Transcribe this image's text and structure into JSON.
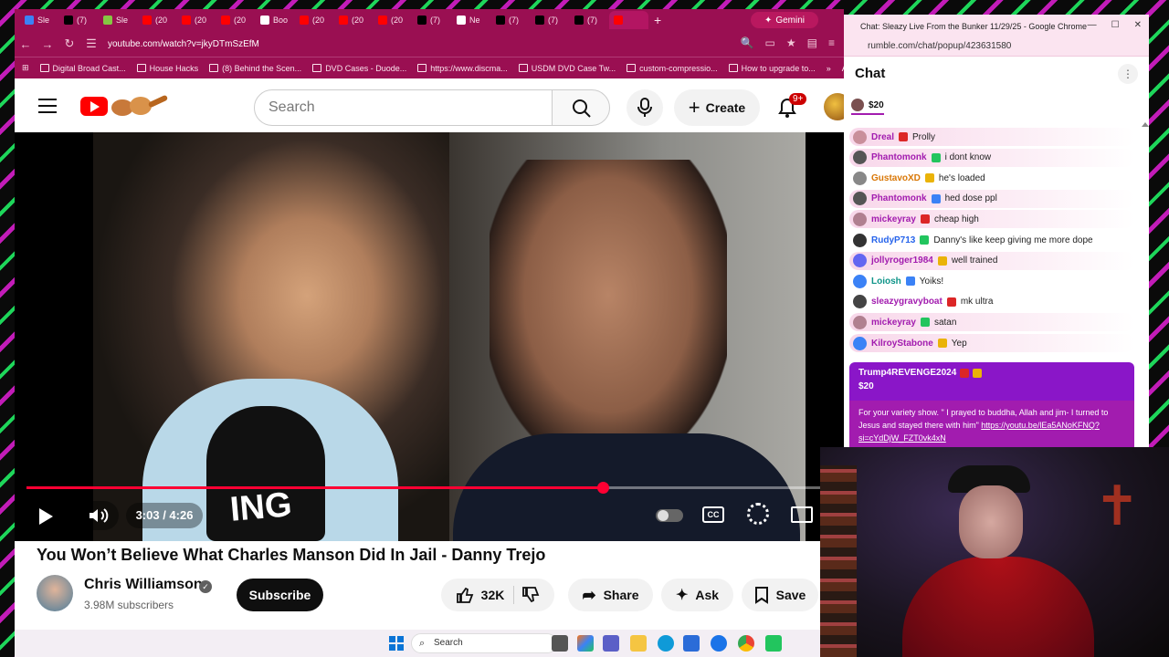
{
  "browser": {
    "tabs": [
      {
        "label": "Sle",
        "icon": "rumble-icon",
        "color": "#3b82f6"
      },
      {
        "label": "(7)",
        "icon": "x-icon",
        "color": "#000000"
      },
      {
        "label": "Sle",
        "icon": "rumble-icon",
        "color": "#85c742"
      },
      {
        "label": "(20",
        "icon": "youtube-icon",
        "color": "#ff0000"
      },
      {
        "label": "(20",
        "icon": "youtube-icon",
        "color": "#ff0000"
      },
      {
        "label": "(20",
        "icon": "youtube-icon",
        "color": "#ff0000"
      },
      {
        "label": "Boo",
        "icon": "star-icon",
        "color": "#ffffff"
      },
      {
        "label": "(20",
        "icon": "youtube-icon",
        "color": "#ff0000"
      },
      {
        "label": "(20",
        "icon": "youtube-icon",
        "color": "#ff0000"
      },
      {
        "label": "(20",
        "icon": "youtube-icon",
        "color": "#ff0000"
      },
      {
        "label": "(7)",
        "icon": "x-icon",
        "color": "#000000"
      },
      {
        "label": "Ne",
        "icon": "openai-icon",
        "color": "#ffffff"
      },
      {
        "label": "(7)",
        "icon": "x-icon",
        "color": "#000000"
      },
      {
        "label": "(7)",
        "icon": "x-icon",
        "color": "#000000"
      },
      {
        "label": "(7)",
        "icon": "x-icon",
        "color": "#000000"
      },
      {
        "label": "",
        "icon": "youtube-icon",
        "color": "#ff0000"
      }
    ],
    "gemini_label": "Gemini",
    "url": "youtube.com/watch?v=jkyDTmSzEfM",
    "bookmarks": [
      "Digital Broad Cast...",
      "House Hacks",
      "(8) Behind the Scen...",
      "DVD Cases - Duode...",
      "https://www.discma...",
      "USDM DVD Case Tw...",
      "custom-compressio...",
      "How to upgrade to..."
    ],
    "bookmarks_overflow": "»",
    "all_bookmarks": "All"
  },
  "youtube": {
    "search_placeholder": "Search",
    "create_label": "Create",
    "notif_count": "9+",
    "video": {
      "current_time": "3:03",
      "duration": "4:26",
      "time_display": "3:03 / 4:26",
      "progress_fraction": 0.7256,
      "cc_label": "CC",
      "mic_text": "ING"
    },
    "title": "You Won’t Believe What Charles Manson Did In Jail - Danny Trejo",
    "channel": {
      "name": "Chris Williamson",
      "subscribers": "3.98M subscribers"
    },
    "subscribe_label": "Subscribe",
    "likes": "32K",
    "share_label": "Share",
    "ask_label": "Ask",
    "save_label": "Save"
  },
  "chat_window": {
    "title": "Chat: Sleazy Live From the Bunker 11/29/25 - Google Chrome",
    "url": "rumble.com/chat/popup/423631580",
    "heading": "Chat",
    "tip_amount": "$20",
    "messages": [
      {
        "user": "Dreal",
        "text": "Prolly",
        "color": "#a21caf",
        "avatar": "#c98f9b",
        "highlight": true
      },
      {
        "user": "Phantomonk",
        "text": "i dont know",
        "color": "#a21caf",
        "avatar": "#555555",
        "highlight": true
      },
      {
        "user": "GustavoXD",
        "text": "he's loaded",
        "color": "#d97706",
        "avatar": "#888888",
        "highlight": false
      },
      {
        "user": "Phantomonk",
        "text": "hed dose ppl",
        "color": "#a21caf",
        "avatar": "#555555",
        "highlight": true
      },
      {
        "user": "mickeyray",
        "text": "cheap high",
        "color": "#a21caf",
        "avatar": "#b08090",
        "highlight": true
      },
      {
        "user": "RudyP713",
        "text": "Danny's like keep giving me more dope",
        "color": "#2563eb",
        "avatar": "#333333",
        "highlight": false
      },
      {
        "user": "jollyroger1984",
        "text": "well trained",
        "color": "#a21caf",
        "avatar": "#6366f1",
        "highlight": true
      },
      {
        "user": "Loiosh",
        "text": "Yoiks!",
        "color": "#0d9488",
        "avatar": "#3b82f6",
        "highlight": false
      },
      {
        "user": "sleazygravyboat",
        "text": "mk ultra",
        "color": "#a21caf",
        "avatar": "#444444",
        "highlight": false
      },
      {
        "user": "mickeyray",
        "text": "satan",
        "color": "#a21caf",
        "avatar": "#b08090",
        "highlight": true
      },
      {
        "user": "KilroyStabone",
        "text": "Yep",
        "color": "#a21caf",
        "avatar": "#3b82f6",
        "highlight": true
      }
    ],
    "rant": {
      "user": "Trump4REVENGE2024",
      "amount": "$20",
      "text": "For your variety show. \" I prayed to buddha, Allah and jim- I turned to Jesus and stayed there with him\"",
      "link": "https://youtu.be/lEa5ANoKFNQ?si=cYdDjW_FZT0vk4xN"
    }
  },
  "taskbar": {
    "search_placeholder": "Search"
  }
}
